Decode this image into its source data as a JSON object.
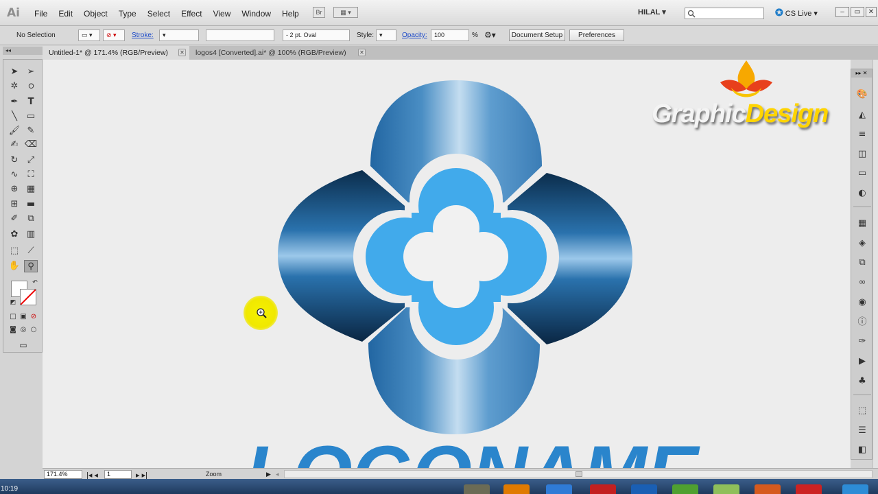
{
  "app": {
    "logo": "Ai",
    "workspace": "HILAL",
    "cs_live": "CS Live",
    "cs_live_icon": "cs-live-icon"
  },
  "menu": [
    "File",
    "Edit",
    "Object",
    "Type",
    "Select",
    "Effect",
    "View",
    "Window",
    "Help"
  ],
  "toolbar_buttons": {
    "bridge": "Br",
    "arrange": "▦ ▾"
  },
  "control": {
    "selection": "No Selection",
    "stroke_label": "Stroke:",
    "brush": "2 pt. Oval",
    "style_label": "Style:",
    "opacity_label": "Opacity:",
    "opacity_value": "100",
    "opacity_unit": "%",
    "document_setup": "Document Setup",
    "preferences": "Preferences"
  },
  "tabs": [
    {
      "label": "Untitled-1* @ 171.4% (RGB/Preview)",
      "active": true
    },
    {
      "label": "logos4 [Converted].ai* @ 100% (RGB/Preview)",
      "active": false
    }
  ],
  "status": {
    "zoom": "171.4%",
    "artboard": "1",
    "tool_name": "Zoom"
  },
  "watermark": {
    "part1": "Graphic",
    "part2": "Design"
  },
  "artwork_text": "LOGONAME",
  "taskbar": {
    "clock": "10:19"
  },
  "colors": {
    "petal_light": "#b3d4ed",
    "petal_mid": "#4a8ec4",
    "petal_dark": "#0b2d4c",
    "inner_flower": "#41aaeb",
    "cursor_highlight": "#f2ea00",
    "accent_link": "#1a48c8"
  },
  "icons": {
    "tools": [
      "selection-tool-icon",
      "direct-selection-tool-icon",
      "magic-wand-tool-icon",
      "lasso-tool-icon",
      "pen-tool-icon",
      "type-tool-icon",
      "line-tool-icon",
      "rectangle-tool-icon",
      "paintbrush-tool-icon",
      "pencil-tool-icon",
      "blob-brush-tool-icon",
      "eraser-tool-icon",
      "rotate-tool-icon",
      "scale-tool-icon",
      "warp-tool-icon",
      "free-transform-tool-icon",
      "shape-builder-tool-icon",
      "perspective-grid-tool-icon",
      "mesh-tool-icon",
      "gradient-tool-icon",
      "eyedropper-tool-icon",
      "blend-tool-icon",
      "symbol-sprayer-tool-icon",
      "column-graph-tool-icon",
      "artboard-tool-icon",
      "slice-tool-icon",
      "hand-tool-icon",
      "zoom-tool-icon"
    ],
    "panels": [
      "color-panel-icon",
      "color-guide-panel-icon",
      "stroke-panel-icon",
      "gradient-panel-icon",
      "transparency-panel-icon",
      "appearance-panel-icon",
      "swatches-panel-icon",
      "layers-panel-icon",
      "artboards-panel-icon",
      "links-panel-icon",
      "navigator-panel-icon",
      "info-panel-icon",
      "brushes-panel-icon",
      "actions-panel-icon",
      "symbols-panel-icon",
      "transform-panel-icon",
      "align-panel-icon",
      "pathfinder-panel-icon"
    ]
  }
}
